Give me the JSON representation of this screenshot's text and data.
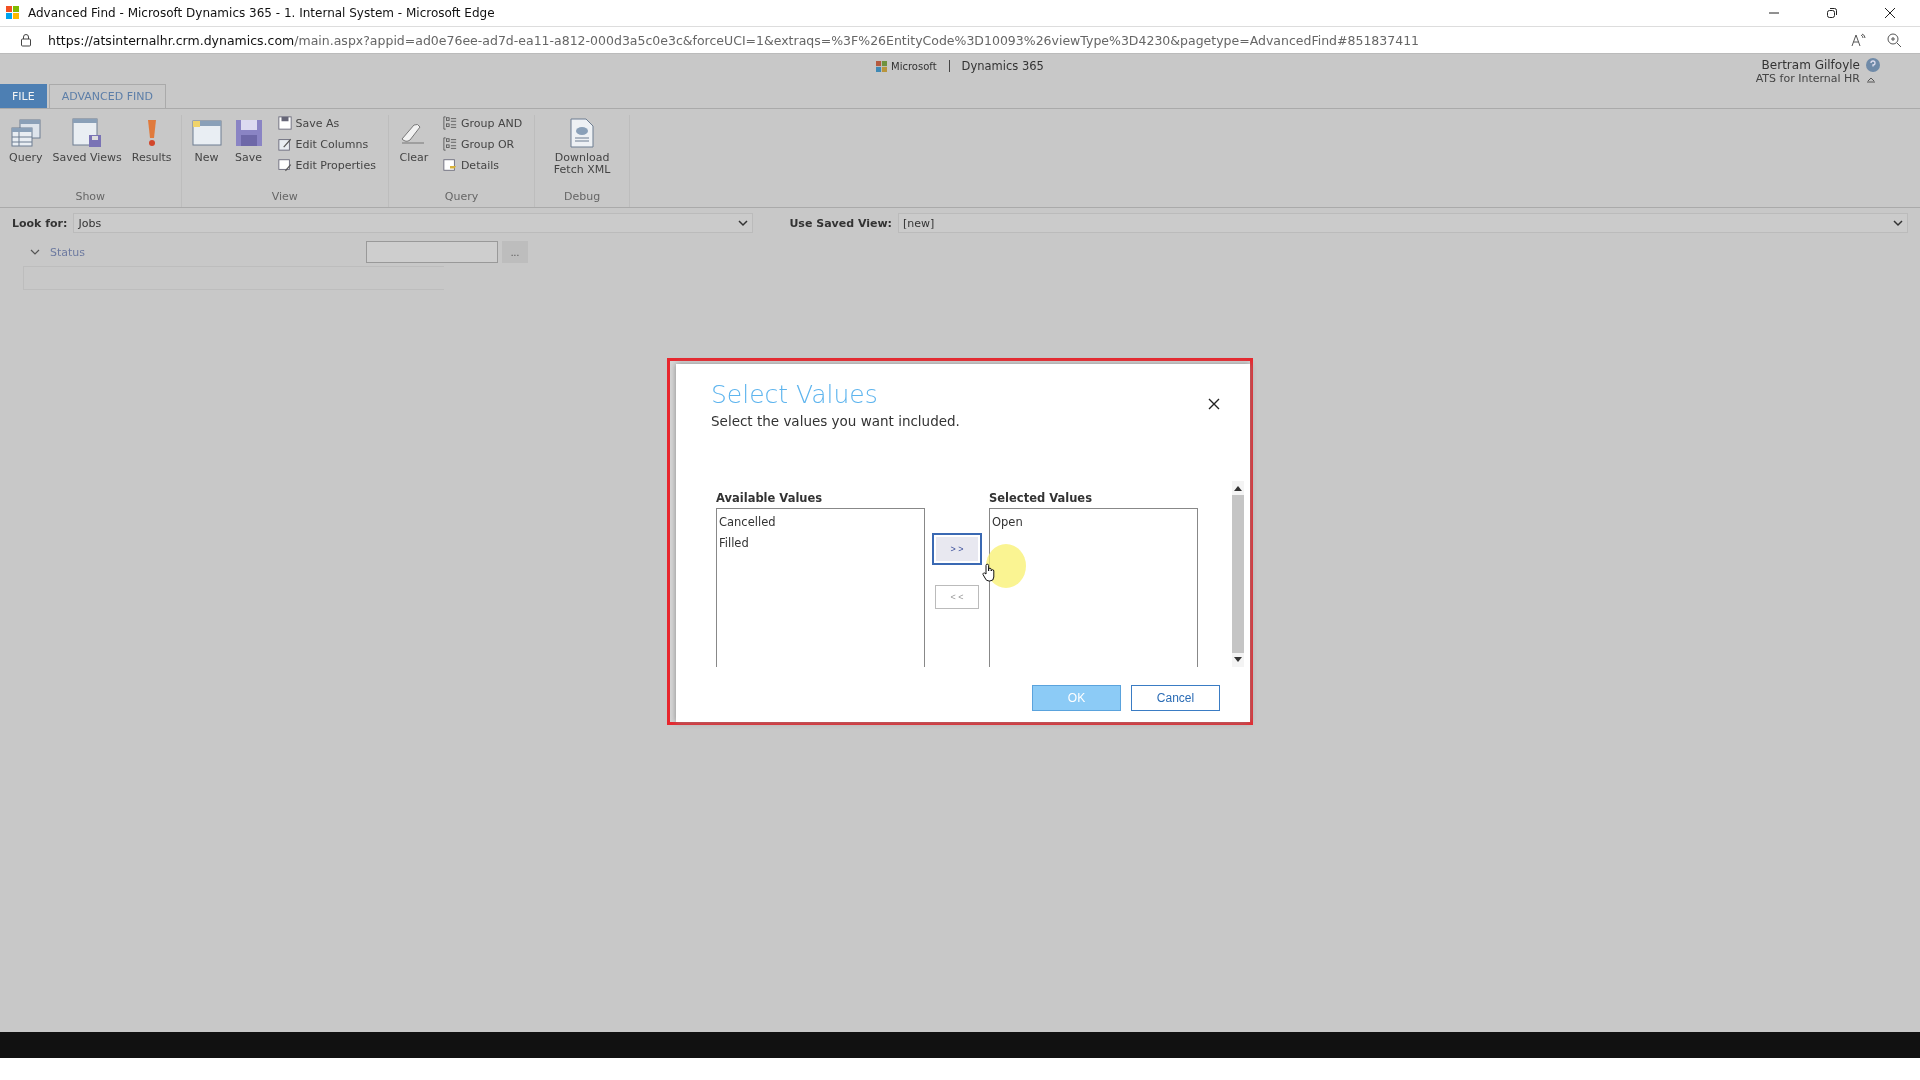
{
  "browser": {
    "title": "Advanced Find - Microsoft Dynamics 365 - 1. Internal System - Microsoft Edge",
    "url_host": "https://atsinternalhr.crm.dynamics.com",
    "url_path": "/main.aspx?appid=ad0e76ee-ad7d-ea11-a812-000d3a5c0e3c&forceUCI=1&extraqs=%3F%26EntityCode%3D10093%26viewType%3D4230&pagetype=AdvancedFind#851837411"
  },
  "header": {
    "brand": "Microsoft",
    "app": "Dynamics 365",
    "user": "Bertram Gilfoyle",
    "org": "ATS for Internal HR"
  },
  "ribbon": {
    "tabs": [
      {
        "label": "FILE",
        "kind": "file",
        "selected": false
      },
      {
        "label": "ADVANCED FIND",
        "kind": "tab",
        "selected": true
      }
    ],
    "groups": [
      {
        "label": "Show",
        "items": [
          {
            "label": "Query",
            "kind": "large"
          },
          {
            "label": "Saved Views",
            "kind": "large"
          },
          {
            "label": "Results",
            "kind": "large"
          }
        ]
      },
      {
        "label": "View",
        "items": [
          {
            "label": "New",
            "kind": "large"
          },
          {
            "label": "Save",
            "kind": "large"
          },
          {
            "label": "Save As",
            "kind": "small"
          },
          {
            "label": "Edit Columns",
            "kind": "small"
          },
          {
            "label": "Edit Properties",
            "kind": "small"
          }
        ]
      },
      {
        "label": "Query",
        "items": [
          {
            "label": "Clear",
            "kind": "large"
          },
          {
            "label": "Group AND",
            "kind": "small"
          },
          {
            "label": "Group OR",
            "kind": "small"
          },
          {
            "label": "Details",
            "kind": "small"
          }
        ]
      },
      {
        "label": "Debug",
        "items": [
          {
            "label": "Download Fetch XML",
            "kind": "large"
          }
        ]
      }
    ]
  },
  "look_for": {
    "label": "Look for:",
    "value": "Jobs"
  },
  "saved_view": {
    "label": "Use Saved View:",
    "value": "[new]"
  },
  "criteria": {
    "field": "Status",
    "more": "..."
  },
  "dialog": {
    "title": "Select Values",
    "subtitle": "Select the values you want included.",
    "available_label": "Available Values",
    "available": [
      "Cancelled",
      "Filled"
    ],
    "selected_label": "Selected Values",
    "selected": [
      "Open"
    ],
    "add": "> >",
    "remove": "< <",
    "ok": "OK",
    "cancel": "Cancel"
  }
}
